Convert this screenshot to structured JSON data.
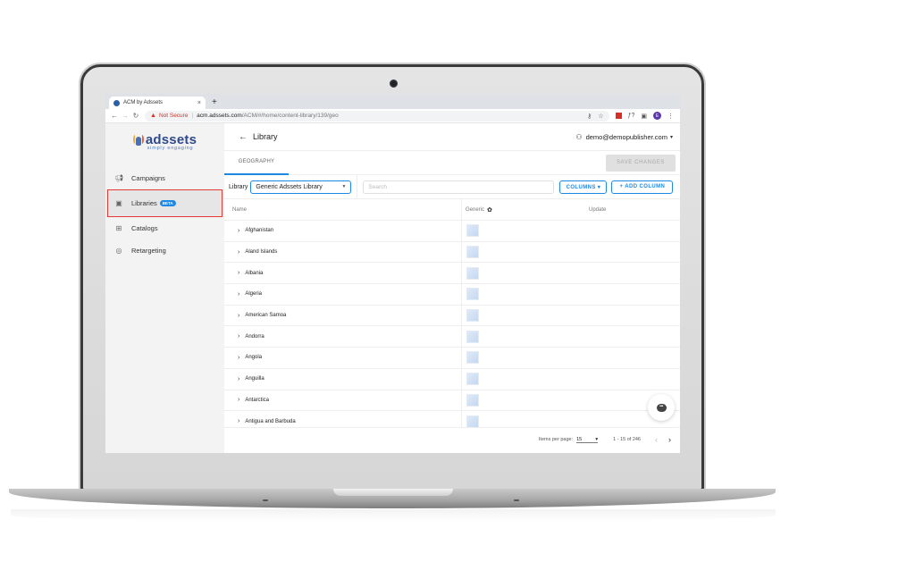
{
  "browser": {
    "tab_title": "ACM by Adssets",
    "tab_close": "×",
    "new_tab": "+",
    "security_label": "Not Secure",
    "url_host": "acm.adssets.com",
    "url_path": "/ACM/#/home/content-library/139/geo",
    "avatar_initial": "E",
    "icons": [
      "key-icon",
      "star-icon",
      "extension-icon",
      "extension-icon",
      "extension-icon",
      "menu-icon"
    ]
  },
  "sidebar": {
    "logo_text": "adssets",
    "logo_tagline": "simply engaging",
    "items": [
      {
        "label": "Campaigns",
        "icon": "megaphone-icon",
        "active": false
      },
      {
        "label": "Libraries",
        "icon": "library-icon",
        "active": true,
        "badge": "BETA"
      },
      {
        "label": "Catalogs",
        "icon": "grid-icon",
        "active": false
      },
      {
        "label": "Retargeting",
        "icon": "target-icon",
        "active": false
      }
    ]
  },
  "header": {
    "title": "Library",
    "user_email": "demo@demopublisher.com"
  },
  "tabs": {
    "active": "GEOGRAPHY",
    "save_label": "SAVE CHANGES"
  },
  "toolbar": {
    "library_label": "Library",
    "library_selected": "Generic Adssets Library",
    "search_placeholder": "Search",
    "columns_label": "COLUMNS ▾",
    "add_column_label": "+ ADD COLUMN"
  },
  "table": {
    "columns": [
      "Name",
      "Generic",
      "Update"
    ],
    "rows": [
      {
        "name": "Afghanistan"
      },
      {
        "name": "Aland Islands"
      },
      {
        "name": "Albania"
      },
      {
        "name": "Algeria"
      },
      {
        "name": "American Samoa"
      },
      {
        "name": "Andorra"
      },
      {
        "name": "Angola"
      },
      {
        "name": "Anguilla"
      },
      {
        "name": "Antarctica"
      },
      {
        "name": "Antigua and Barbuda"
      }
    ]
  },
  "pagination": {
    "items_per_page_label": "Items per page:",
    "items_per_page": "15",
    "range": "1 - 15 of 246"
  }
}
